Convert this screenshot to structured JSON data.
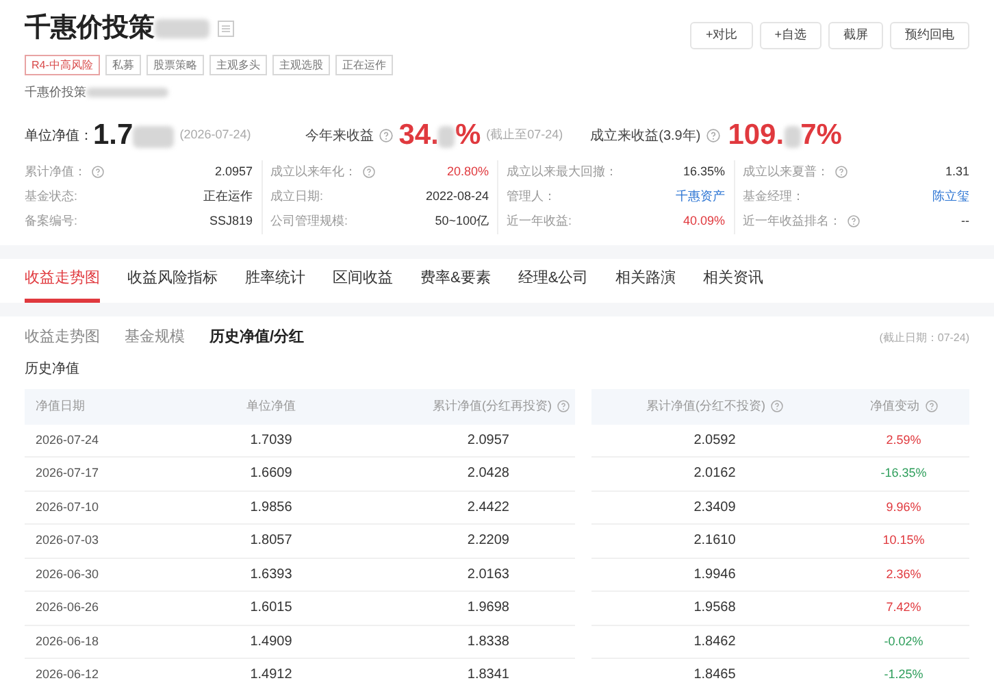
{
  "header": {
    "title": "千惠价投策",
    "subtitle": "千惠价投策",
    "tags": [
      {
        "label": "R4-中高风险",
        "kind": "risk"
      },
      {
        "label": "私募",
        "kind": "plain"
      },
      {
        "label": "股票策略",
        "kind": "plain"
      },
      {
        "label": "主观多头",
        "kind": "plain"
      },
      {
        "label": "主观选股",
        "kind": "plain"
      },
      {
        "label": "正在运作",
        "kind": "plain"
      }
    ],
    "buttons": [
      "+对比",
      "+自选",
      "截屏",
      "预约回电"
    ]
  },
  "headline": {
    "nav_label": "单位净值：",
    "nav_value": "1.7",
    "nav_date": "(2026-07-24)",
    "ytd_label": "今年来收益",
    "ytd_head": "34.",
    "ytd_tail": "%",
    "ytd_note": "(截止至07-24)",
    "total_label": "成立来收益(3.9年)",
    "total_head": "109.",
    "total_tail": "7%"
  },
  "stats": [
    {
      "label": "累计净值：",
      "help": true,
      "value": "2.0957",
      "kind": "plain"
    },
    {
      "label": "成立以来年化：",
      "help": true,
      "value": "20.80%",
      "kind": "red"
    },
    {
      "label": "成立以来最大回撤：",
      "help": false,
      "value": "16.35%",
      "kind": "plain"
    },
    {
      "label": "成立以来夏普：",
      "help": true,
      "value": "1.31",
      "kind": "plain"
    },
    {
      "label": "基金状态:",
      "help": false,
      "value": "正在运作",
      "kind": "plain"
    },
    {
      "label": "成立日期:",
      "help": false,
      "value": "2022-08-24",
      "kind": "plain"
    },
    {
      "label": "管理人：",
      "help": false,
      "value": "千惠资产",
      "kind": "link"
    },
    {
      "label": "基金经理：",
      "help": false,
      "value": "陈立玺",
      "kind": "link"
    },
    {
      "label": "备案编号:",
      "help": false,
      "value": "SSJ819",
      "kind": "plain"
    },
    {
      "label": "公司管理规模:",
      "help": false,
      "value": "50~100亿",
      "kind": "plain"
    },
    {
      "label": "近一年收益:",
      "help": false,
      "value": "40.09%",
      "kind": "red"
    },
    {
      "label": "近一年收益排名：",
      "help": true,
      "value": "--",
      "kind": "plain"
    }
  ],
  "tabs": [
    {
      "label": "收益走势图",
      "selected": true
    },
    {
      "label": "收益风险指标",
      "selected": false
    },
    {
      "label": "胜率统计",
      "selected": false
    },
    {
      "label": "区间收益",
      "selected": false
    },
    {
      "label": "费率&要素",
      "selected": false
    },
    {
      "label": "经理&公司",
      "selected": false
    },
    {
      "label": "相关路演",
      "selected": false
    },
    {
      "label": "相关资讯",
      "selected": false
    }
  ],
  "subtabs": [
    {
      "label": "收益走势图",
      "selected": false
    },
    {
      "label": "基金规模",
      "selected": false
    },
    {
      "label": "历史净值/分红",
      "selected": true
    }
  ],
  "as_of": "(截止日期：07-24)",
  "section_title": "历史净值",
  "table": {
    "columns": [
      {
        "label": "净值日期",
        "help": false
      },
      {
        "label": "单位净值",
        "help": false
      },
      {
        "label": "累计净值(分红再投资)",
        "help": true
      },
      {
        "label": "累计净值(分红不投资)",
        "help": true
      },
      {
        "label": "净值变动",
        "help": true
      }
    ],
    "rows": [
      {
        "date": "2026-07-24",
        "nav": "1.7039",
        "acc_reinvest": "2.0957",
        "acc_plain": "2.0592",
        "change": "2.59%",
        "color": "#e0393e"
      },
      {
        "date": "2026-07-17",
        "nav": "1.6609",
        "acc_reinvest": "2.0428",
        "acc_plain": "2.0162",
        "change": "-16.35%",
        "color": "#2e9e5b"
      },
      {
        "date": "2026-07-10",
        "nav": "1.9856",
        "acc_reinvest": "2.4422",
        "acc_plain": "2.3409",
        "change": "9.96%",
        "color": "#e0393e"
      },
      {
        "date": "2026-07-03",
        "nav": "1.8057",
        "acc_reinvest": "2.2209",
        "acc_plain": "2.1610",
        "change": "10.15%",
        "color": "#e0393e"
      },
      {
        "date": "2026-06-30",
        "nav": "1.6393",
        "acc_reinvest": "2.0163",
        "acc_plain": "1.9946",
        "change": "2.36%",
        "color": "#e0393e"
      },
      {
        "date": "2026-06-26",
        "nav": "1.6015",
        "acc_reinvest": "1.9698",
        "acc_plain": "1.9568",
        "change": "7.42%",
        "color": "#e0393e"
      },
      {
        "date": "2026-06-18",
        "nav": "1.4909",
        "acc_reinvest": "1.8338",
        "acc_plain": "1.8462",
        "change": "-0.02%",
        "color": "#2e9e5b"
      },
      {
        "date": "2026-06-12",
        "nav": "1.4912",
        "acc_reinvest": "1.8341",
        "acc_plain": "1.8465",
        "change": "-1.25%",
        "color": "#2e9e5b"
      }
    ]
  }
}
